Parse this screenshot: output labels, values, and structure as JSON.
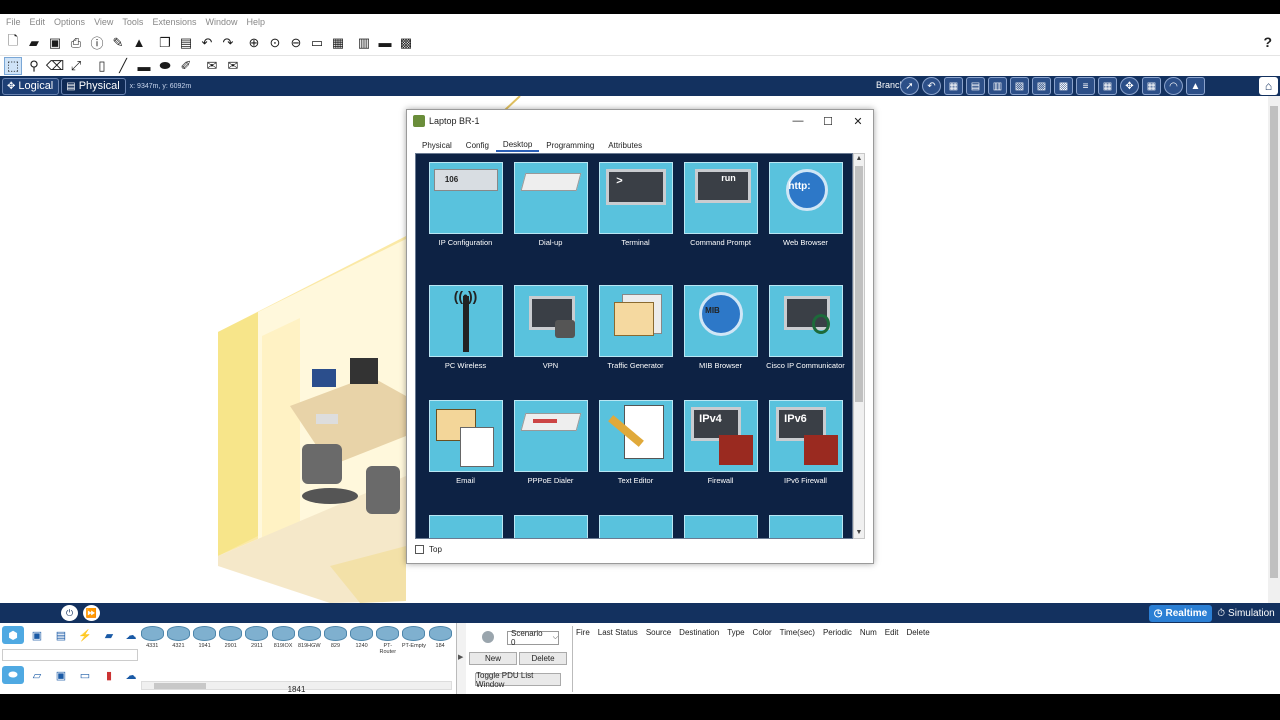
{
  "menu": [
    "File",
    "Edit",
    "Options",
    "View",
    "Tools",
    "Extensions",
    "Window",
    "Help"
  ],
  "toolbar1_icons": [
    "new-file-icon",
    "open-folder-icon",
    "save-icon",
    "print-icon",
    "info-icon",
    "activity-wizard-icon",
    "custom-device-icon",
    "copy-icon",
    "paste-icon",
    "undo-icon",
    "redo-icon",
    "zoom-in-icon",
    "zoom-reset-icon",
    "zoom-out-icon",
    "drawing-palette-icon",
    "custom-devices-dialog-icon",
    "viewport-icon",
    "pdu-icon",
    "screenshot-icon"
  ],
  "toolbar2_icons": [
    "select-icon",
    "inspect-icon",
    "delete-icon",
    "resize-icon",
    "note-icon",
    "line-icon",
    "rectangle-icon",
    "ellipse-icon",
    "freeform-icon",
    "simple-pdu-icon",
    "complex-pdu-icon"
  ],
  "help_label": "?",
  "workspace": {
    "logical_label": "Logical",
    "physical_label": "Physical",
    "coords": "x: 9347m, y: 6092m",
    "branch_label": "Branch"
  },
  "window": {
    "title": "Laptop BR-1",
    "tabs": [
      "Physical",
      "Config",
      "Desktop",
      "Programming",
      "Attributes"
    ],
    "active_tab": "Desktop",
    "top_label": "Top",
    "apps": [
      {
        "label": "IP Configuration"
      },
      {
        "label": "Dial-up"
      },
      {
        "label": "Terminal"
      },
      {
        "label": "Command Prompt"
      },
      {
        "label": "Web Browser"
      },
      {
        "label": "PC Wireless"
      },
      {
        "label": "VPN"
      },
      {
        "label": "Traffic Generator"
      },
      {
        "label": "MIB Browser"
      },
      {
        "label": "Cisco IP Communicator"
      },
      {
        "label": "Email"
      },
      {
        "label": "PPPoE Dialer"
      },
      {
        "label": "Text Editor"
      },
      {
        "label": "Firewall"
      },
      {
        "label": "IPv6 Firewall"
      }
    ],
    "tile_glyphs": {
      "ip_config": "106",
      "terminal": ">",
      "command_prompt": "run",
      "web_browser": "http:",
      "mib": "MIB",
      "firewall": "IPv4",
      "ipv6_firewall": "IPv6"
    }
  },
  "bottom": {
    "realtime_label": "Realtime",
    "simulation_label": "Simulation",
    "devices": [
      "4331",
      "4321",
      "1941",
      "2901",
      "2911",
      "819IOX",
      "819HGW",
      "829",
      "1240",
      "PT-Router",
      "PT-Empty",
      "184"
    ],
    "selected_model": "1841",
    "scenario_value": "Scenario 0",
    "new_label": "New",
    "delete_label": "Delete",
    "toggle_label": "Toggle PDU List Window",
    "pdu_columns": [
      "Fire",
      "Last Status",
      "Source",
      "Destination",
      "Type",
      "Color",
      "Time(sec)",
      "Periodic",
      "Num",
      "Edit",
      "Delete"
    ]
  },
  "colors": {
    "workspace_bar": "#13315f",
    "desktop_bg": "#0d2244",
    "tile": "#59c2dd",
    "realtime": "#2b7fd4"
  }
}
